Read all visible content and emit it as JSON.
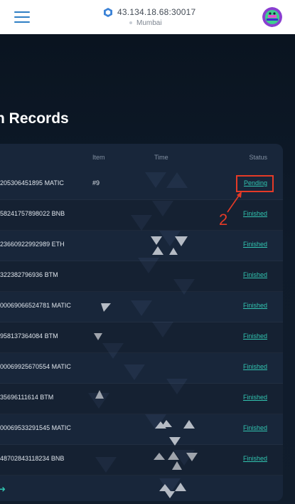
{
  "header": {
    "server_ip": "43.134.18.68:30017",
    "location": "Mumbai"
  },
  "page": {
    "title_hidden": "n",
    "title": "Records"
  },
  "table": {
    "columns": {
      "item": "Item",
      "time": "Time",
      "status": "Status"
    },
    "rows": [
      {
        "order": "205306451895 MATIC",
        "item": "#9",
        "status": "Pending"
      },
      {
        "order": "58241757898022 BNB",
        "item": "",
        "status": "Finished"
      },
      {
        "order": "23660922992989 ETH",
        "item": "",
        "status": "Finished"
      },
      {
        "order": "322382796936 BTM",
        "item": "",
        "status": "Finished"
      },
      {
        "order": "00069066524781 MATIC",
        "item": "",
        "status": "Finished"
      },
      {
        "order": "958137364084 BTM",
        "item": "",
        "status": "Finished"
      },
      {
        "order": "00069925670554 MATIC",
        "item": "",
        "status": "Finished"
      },
      {
        "order": "35696111614 BTM",
        "item": "",
        "status": "Finished"
      },
      {
        "order": "00069533291545 MATIC",
        "item": "",
        "status": "Finished"
      },
      {
        "order": "48702843118234 BNB",
        "item": "",
        "status": "Finished"
      }
    ]
  },
  "annotation": {
    "label": "2",
    "color": "#e53a27"
  },
  "colors": {
    "accent": "#31c4b0",
    "brand_blue": "#2f7fc4",
    "background": "#0c1624"
  },
  "icons": {
    "menu": "hamburger-icon",
    "server": "cube-icon",
    "more": "arrow-right-icon"
  }
}
